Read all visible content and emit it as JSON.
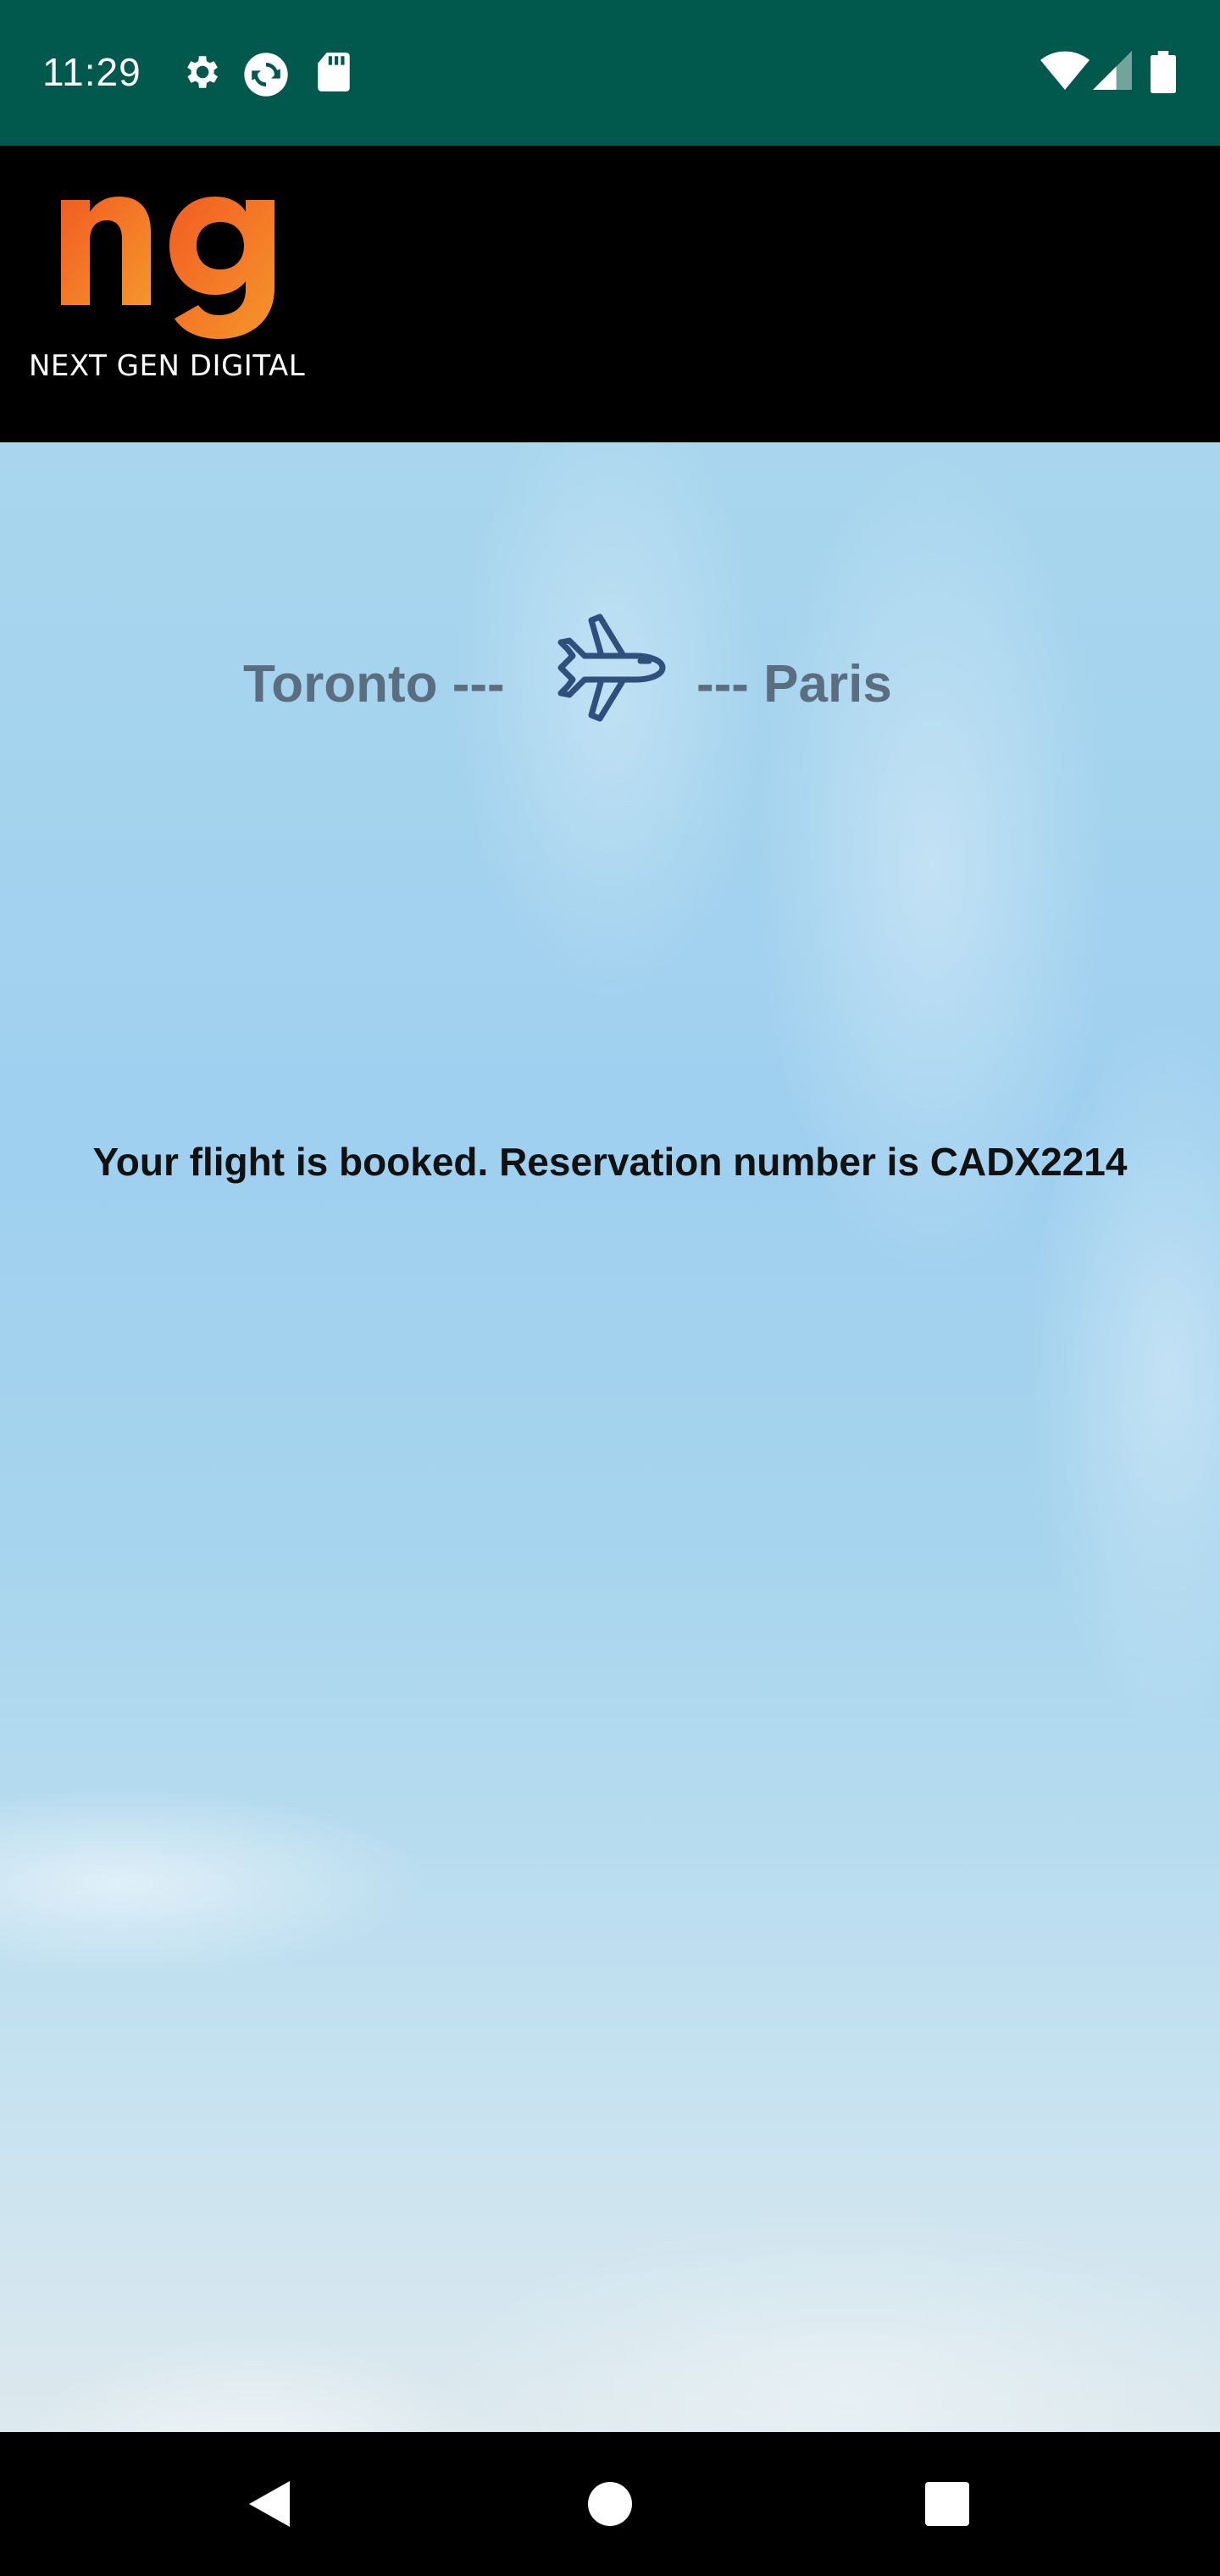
{
  "status_bar": {
    "time": "11:29",
    "icons": [
      "gear-icon",
      "sync-icon",
      "sd-card-icon",
      "wifi-icon",
      "cell-signal-icon",
      "battery-icon"
    ],
    "background": "#00594C"
  },
  "header": {
    "logo_text": "ng",
    "logo_caption": "NEXT GEN DIGITAL",
    "logo_color": "#F36F21"
  },
  "route": {
    "origin": "Toronto ---",
    "destination": "--- Paris",
    "icon": "airplane-icon"
  },
  "confirmation": {
    "message": "Your flight is booked. Reservation number is CADX2214"
  },
  "nav_bar": {
    "buttons": [
      "back-icon",
      "home-icon",
      "recents-icon"
    ]
  }
}
